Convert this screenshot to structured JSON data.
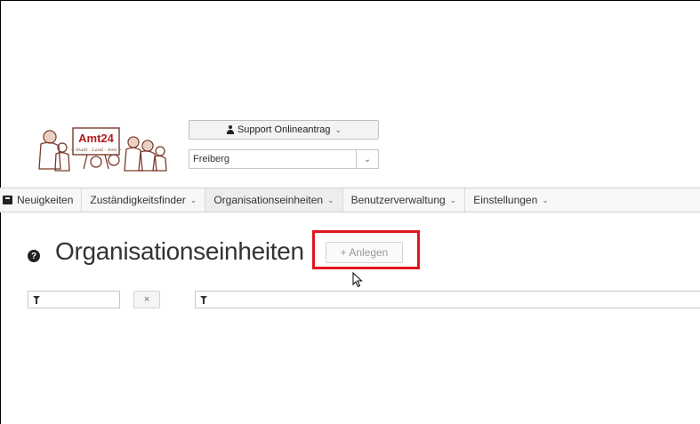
{
  "header": {
    "logo": {
      "text": "Amt24",
      "tagline": "~ Stadt · Land · Amt ~"
    },
    "user_menu": {
      "label": "Support Onlineantrag",
      "icon": "user-icon"
    },
    "location_select": {
      "value": "Freiberg"
    }
  },
  "nav": {
    "items": [
      {
        "label": "Neuigkeiten",
        "icon": "news-icon",
        "dropdown": false
      },
      {
        "label": "Zuständigkeitsfinder",
        "dropdown": true
      },
      {
        "label": "Organisationseinheiten",
        "dropdown": true,
        "active": true
      },
      {
        "label": "Benutzerverwaltung",
        "dropdown": true
      },
      {
        "label": "Einstellungen",
        "dropdown": true
      }
    ]
  },
  "main": {
    "title": "Organisationseinheiten",
    "add_button": "+ Anlegen",
    "filter_1": {
      "value": ""
    },
    "clear_label": "×",
    "filter_2": {
      "value": ""
    }
  },
  "colors": {
    "highlight": "#e0151f",
    "nav_bg": "#f7f7f7"
  }
}
